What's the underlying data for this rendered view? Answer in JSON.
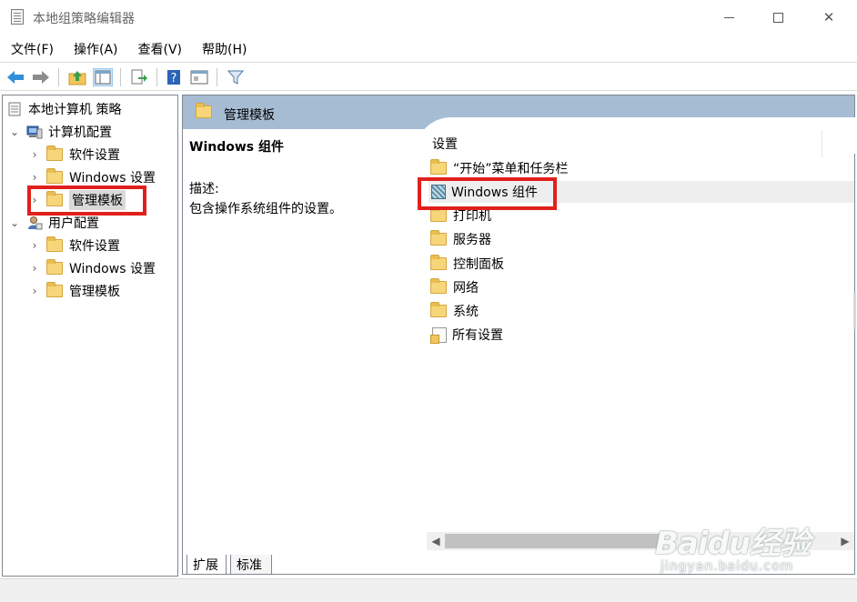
{
  "window": {
    "title": "本地组策略编辑器",
    "minimize_glyph": "—",
    "maximize_glyph": "☐",
    "close_glyph": "✕"
  },
  "menu": {
    "items": [
      "文件(F)",
      "操作(A)",
      "查看(V)",
      "帮助(H)"
    ]
  },
  "toolbar": {
    "buttons": [
      "back-icon",
      "forward-icon",
      "up-folder-icon",
      "show-tree-icon",
      "export-list-icon",
      "help-icon",
      "properties-icon",
      "filter-icon"
    ]
  },
  "tree": {
    "root": "本地计算机 策略",
    "computer": {
      "label": "计算机配置",
      "children": [
        "软件设置",
        "Windows 设置",
        "管理模板"
      ]
    },
    "user": {
      "label": "用户配置",
      "children": [
        "软件设置",
        "Windows 设置",
        "管理模板"
      ]
    }
  },
  "right": {
    "header": "管理模板",
    "selected_title": "Windows 组件",
    "desc_label": "描述:",
    "desc_text": "包含操作系统组件的设置。",
    "column_header": "设置",
    "items": [
      "“开始”菜单和任务栏",
      "Windows 组件",
      "打印机",
      "服务器",
      "控制面板",
      "网络",
      "系统",
      "所有设置"
    ]
  },
  "tabs": {
    "expand": "扩展",
    "standard": "标准"
  },
  "watermark": {
    "logo": "Baidu经验",
    "url": "jingyan.baidu.com"
  },
  "colors": {
    "header_bg": "#a6bcd3",
    "highlight": "#e0201d",
    "folder": "#f7d67a"
  }
}
